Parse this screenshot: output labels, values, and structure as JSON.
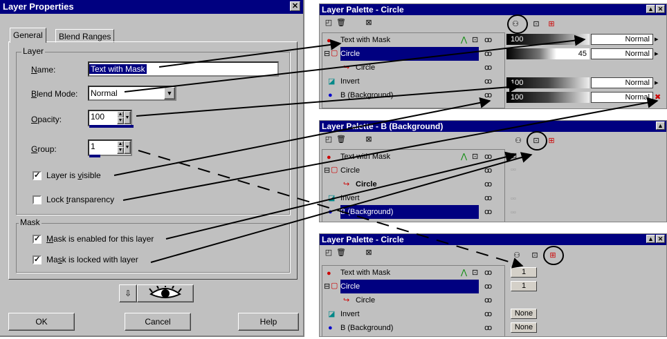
{
  "dialog": {
    "title": "Layer Properties",
    "close": "✕",
    "tabs": [
      "General",
      "Blend Ranges"
    ],
    "layer_group": "Layer",
    "name_label": "Name:",
    "name_value": "Text with Mask",
    "blend_label": "Blend Mode:",
    "blend_value": "Normal",
    "opacity_label": "Opacity:",
    "opacity_value": "100",
    "group_label": "Group:",
    "group_value": "1",
    "visible_label": "Layer is visible",
    "lock_label": "Lock transparency",
    "mask_group": "Mask",
    "mask_enabled_label": "Mask is enabled for this layer",
    "mask_locked_label": "Mask is locked with layer",
    "ok": "OK",
    "cancel": "Cancel",
    "help": "Help",
    "checks": {
      "visible": true,
      "lock": false,
      "mask_enabled": true,
      "mask_locked": true
    }
  },
  "palette1": {
    "title": "Layer Palette - Circle",
    "layers": [
      "Text with Mask",
      "Circle",
      "Circle",
      "Invert",
      "B (Background)"
    ],
    "opacity": [
      "100",
      "45",
      "100",
      "100"
    ],
    "modes": [
      "Normal",
      "Normal",
      "Normal",
      "Normal"
    ]
  },
  "palette2": {
    "title": "Layer Palette - B (Background)",
    "layers": [
      "Text with Mask",
      "Circle",
      "Circle",
      "Invert",
      "B (Background)"
    ]
  },
  "palette3": {
    "title": "Layer Palette - Circle",
    "layers": [
      "Text with Mask",
      "Circle",
      "Circle",
      "Invert",
      "B (Background)"
    ],
    "groups": [
      "1",
      "1",
      "None",
      "None"
    ]
  },
  "colors": {
    "titlebar": "#000080",
    "face": "#c0c0c0",
    "selection": "#000080"
  }
}
